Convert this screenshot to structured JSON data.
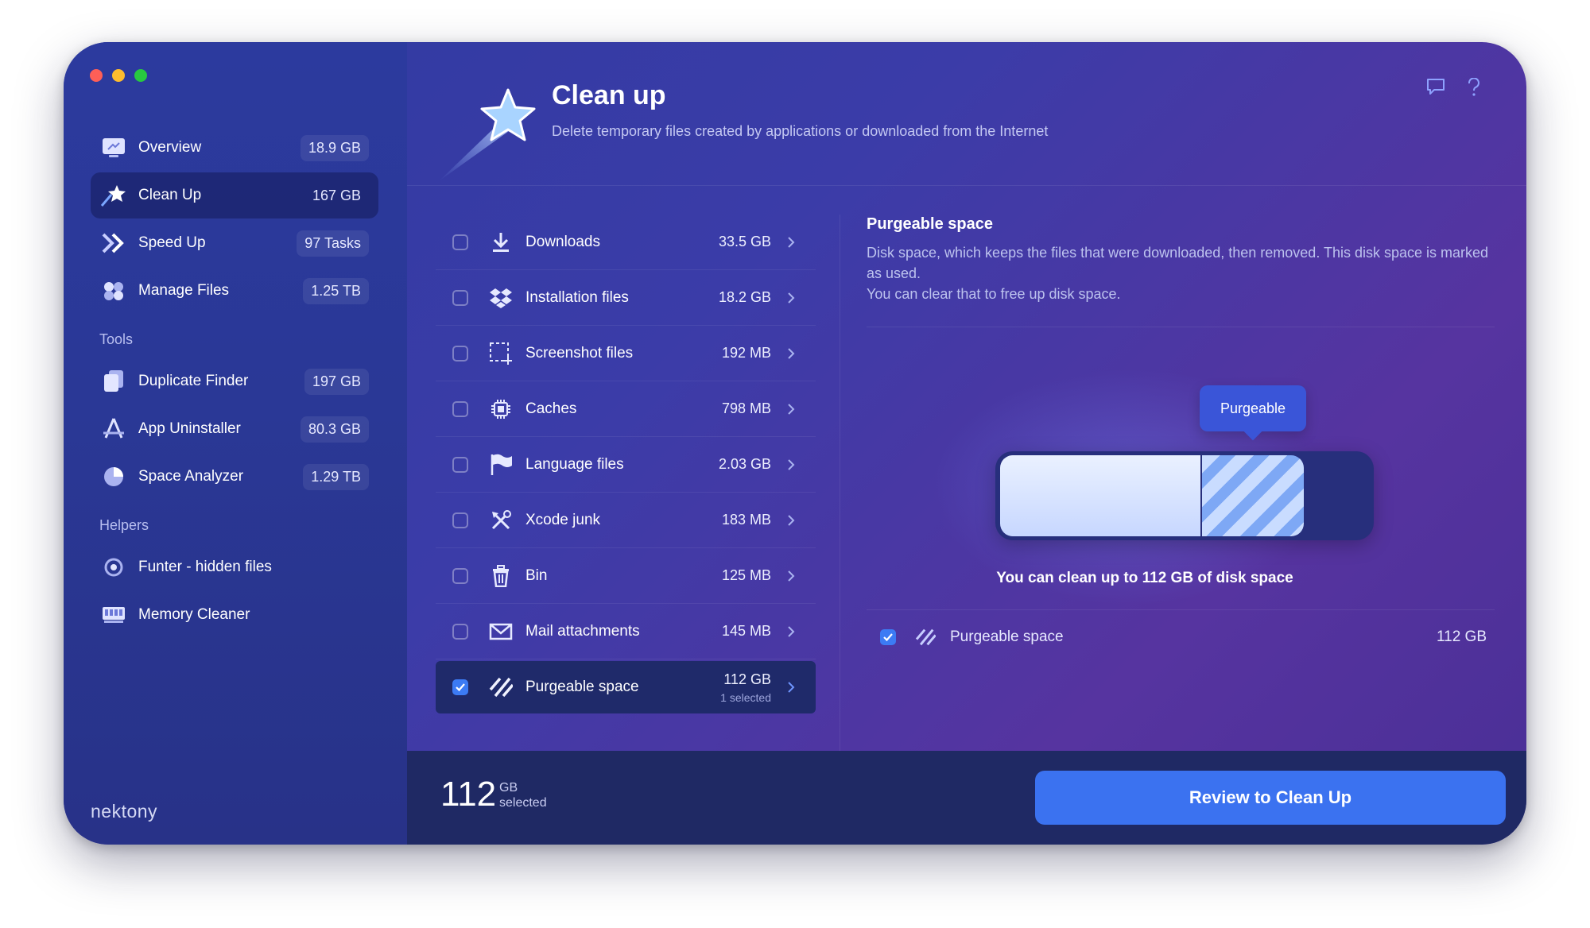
{
  "sidebar": {
    "items": [
      {
        "label": "Overview",
        "value": "18.9 GB",
        "icon": "overview-icon"
      },
      {
        "label": "Clean Up",
        "value": "167 GB",
        "icon": "cleanup-star-icon",
        "active": true
      },
      {
        "label": "Speed Up",
        "value": "97 Tasks",
        "icon": "speedup-icon"
      },
      {
        "label": "Manage Files",
        "value": "1.25 TB",
        "icon": "manage-files-icon"
      }
    ],
    "tools_title": "Tools",
    "tools": [
      {
        "label": "Duplicate Finder",
        "value": "197 GB",
        "icon": "duplicate-icon"
      },
      {
        "label": "App Uninstaller",
        "value": "80.3 GB",
        "icon": "uninstaller-icon"
      },
      {
        "label": "Space Analyzer",
        "value": "1.29 TB",
        "icon": "space-analyzer-icon"
      }
    ],
    "helpers_title": "Helpers",
    "helpers": [
      {
        "label": "Funter - hidden files",
        "icon": "funter-icon"
      },
      {
        "label": "Memory Cleaner",
        "icon": "memory-icon"
      }
    ],
    "brand": "nektony"
  },
  "header": {
    "title": "Clean up",
    "subtitle": "Delete temporary files created by applications or downloaded from the Internet"
  },
  "categories": [
    {
      "label": "Downloads",
      "size": "33.5 GB",
      "checked": false,
      "icon": "download-icon"
    },
    {
      "label": "Installation files",
      "size": "18.2 GB",
      "checked": false,
      "icon": "dropbox-icon"
    },
    {
      "label": "Screenshot files",
      "size": "192 MB",
      "checked": false,
      "icon": "screenshot-icon"
    },
    {
      "label": "Caches",
      "size": "798 MB",
      "checked": false,
      "icon": "chip-icon"
    },
    {
      "label": "Language files",
      "size": "2.03 GB",
      "checked": false,
      "icon": "flag-icon"
    },
    {
      "label": "Xcode junk",
      "size": "183 MB",
      "checked": false,
      "icon": "tools-icon"
    },
    {
      "label": "Bin",
      "size": "125 MB",
      "checked": false,
      "icon": "trash-icon"
    },
    {
      "label": "Mail attachments",
      "size": "145 MB",
      "checked": false,
      "icon": "mail-icon"
    },
    {
      "label": "Purgeable space",
      "size": "112 GB",
      "sub": "1 selected",
      "checked": true,
      "icon": "striped-icon"
    }
  ],
  "detail": {
    "title": "Purgeable space",
    "desc1": "Disk space, which keeps the files that were downloaded, then removed. This disk space is marked as used.",
    "desc2": "You can clear that to free up disk space.",
    "tooltip": "Purgeable",
    "clean_text": "You can clean up to 112 GB of disk space",
    "row_label": "Purgeable space",
    "row_size": "112 GB"
  },
  "footer": {
    "amount": "112",
    "unit": "GB",
    "unit_sub": "selected",
    "button": "Review to Clean Up"
  },
  "colors": {
    "accent": "#3b72f0",
    "sidebar": "#2c3a9e",
    "footer": "#1f2964"
  }
}
